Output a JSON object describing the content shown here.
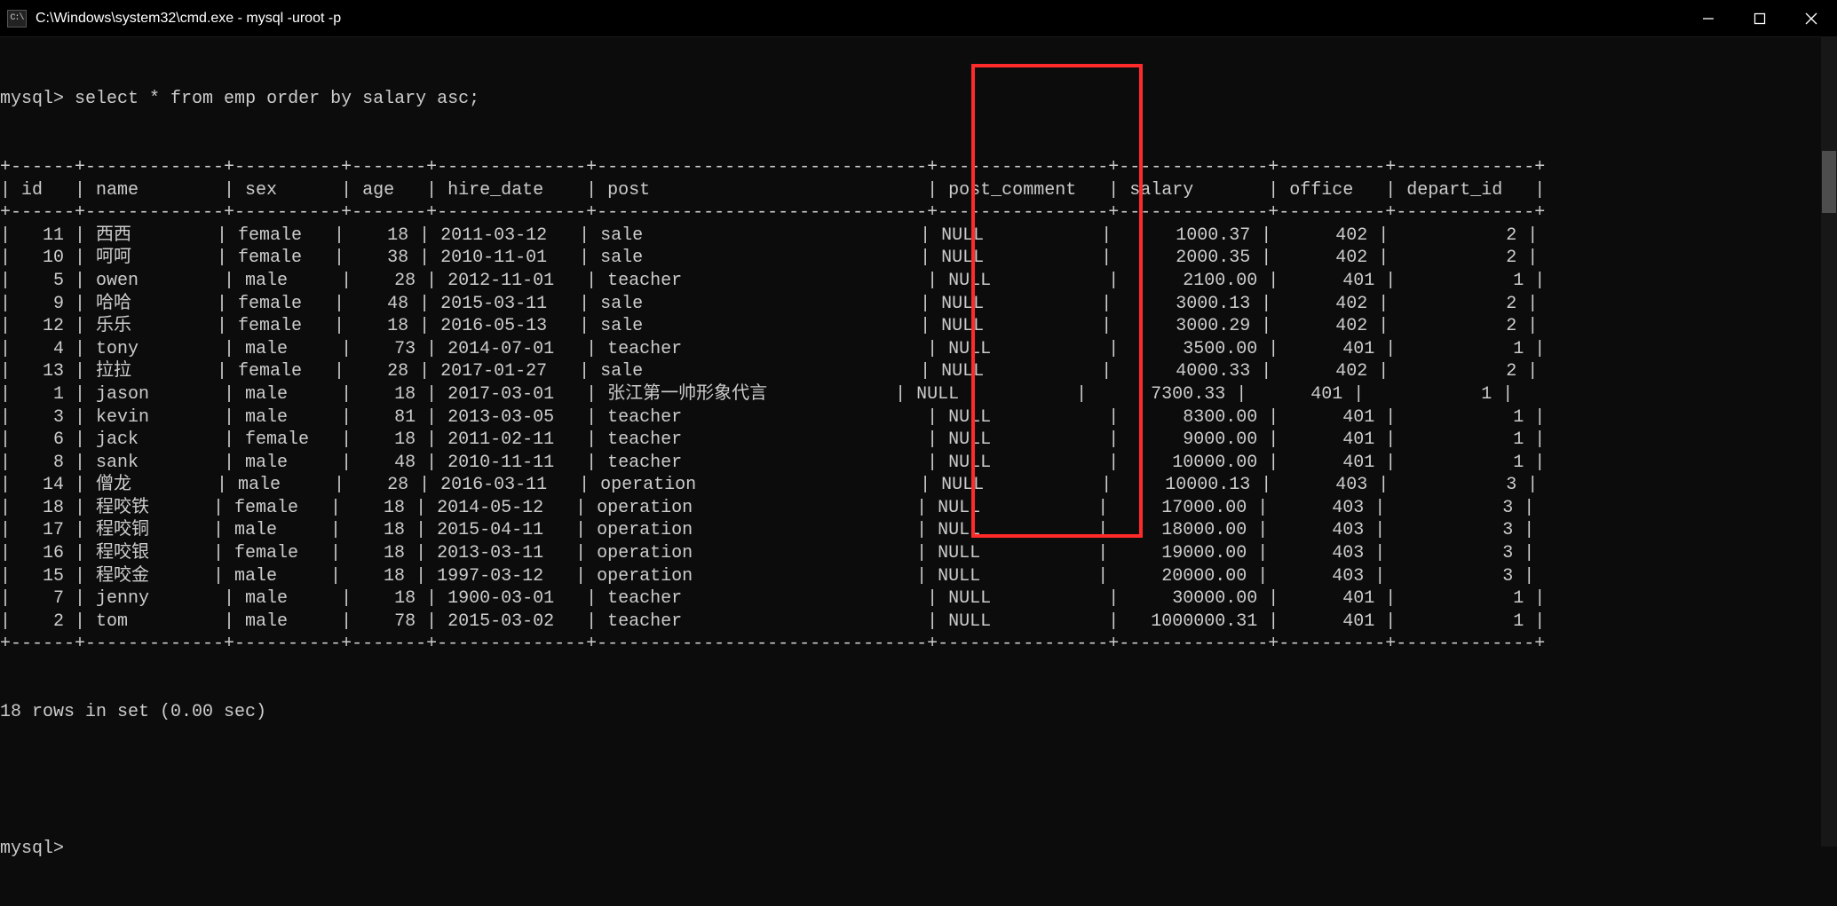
{
  "titlebar": {
    "icon_label": "cmd-icon",
    "text": "C:\\Windows\\system32\\cmd.exe - mysql  -uroot -p"
  },
  "prompt": "mysql>",
  "query": "select * from emp order by salary asc;",
  "columns": [
    "id",
    "name",
    "sex",
    "age",
    "hire_date",
    "post",
    "post_comment",
    "salary",
    "office",
    "depart_id"
  ],
  "rows": [
    {
      "id": "11",
      "name": "西西",
      "sex": "female",
      "age": "18",
      "hire_date": "2011-03-12",
      "post": "sale",
      "post_comment": "NULL",
      "salary": "1000.37",
      "office": "402",
      "depart_id": "2"
    },
    {
      "id": "10",
      "name": "呵呵",
      "sex": "female",
      "age": "38",
      "hire_date": "2010-11-01",
      "post": "sale",
      "post_comment": "NULL",
      "salary": "2000.35",
      "office": "402",
      "depart_id": "2"
    },
    {
      "id": "5",
      "name": "owen",
      "sex": "male",
      "age": "28",
      "hire_date": "2012-11-01",
      "post": "teacher",
      "post_comment": "NULL",
      "salary": "2100.00",
      "office": "401",
      "depart_id": "1"
    },
    {
      "id": "9",
      "name": "哈哈",
      "sex": "female",
      "age": "48",
      "hire_date": "2015-03-11",
      "post": "sale",
      "post_comment": "NULL",
      "salary": "3000.13",
      "office": "402",
      "depart_id": "2"
    },
    {
      "id": "12",
      "name": "乐乐",
      "sex": "female",
      "age": "18",
      "hire_date": "2016-05-13",
      "post": "sale",
      "post_comment": "NULL",
      "salary": "3000.29",
      "office": "402",
      "depart_id": "2"
    },
    {
      "id": "4",
      "name": "tony",
      "sex": "male",
      "age": "73",
      "hire_date": "2014-07-01",
      "post": "teacher",
      "post_comment": "NULL",
      "salary": "3500.00",
      "office": "401",
      "depart_id": "1"
    },
    {
      "id": "13",
      "name": "拉拉",
      "sex": "female",
      "age": "28",
      "hire_date": "2017-01-27",
      "post": "sale",
      "post_comment": "NULL",
      "salary": "4000.33",
      "office": "402",
      "depart_id": "2"
    },
    {
      "id": "1",
      "name": "jason",
      "sex": "male",
      "age": "18",
      "hire_date": "2017-03-01",
      "post": "张江第一帅形象代言",
      "post_comment": "NULL",
      "salary": "7300.33",
      "office": "401",
      "depart_id": "1"
    },
    {
      "id": "3",
      "name": "kevin",
      "sex": "male",
      "age": "81",
      "hire_date": "2013-03-05",
      "post": "teacher",
      "post_comment": "NULL",
      "salary": "8300.00",
      "office": "401",
      "depart_id": "1"
    },
    {
      "id": "6",
      "name": "jack",
      "sex": "female",
      "age": "18",
      "hire_date": "2011-02-11",
      "post": "teacher",
      "post_comment": "NULL",
      "salary": "9000.00",
      "office": "401",
      "depart_id": "1"
    },
    {
      "id": "8",
      "name": "sank",
      "sex": "male",
      "age": "48",
      "hire_date": "2010-11-11",
      "post": "teacher",
      "post_comment": "NULL",
      "salary": "10000.00",
      "office": "401",
      "depart_id": "1"
    },
    {
      "id": "14",
      "name": "僧龙",
      "sex": "male",
      "age": "28",
      "hire_date": "2016-03-11",
      "post": "operation",
      "post_comment": "NULL",
      "salary": "10000.13",
      "office": "403",
      "depart_id": "3"
    },
    {
      "id": "18",
      "name": "程咬铁",
      "sex": "female",
      "age": "18",
      "hire_date": "2014-05-12",
      "post": "operation",
      "post_comment": "NULL",
      "salary": "17000.00",
      "office": "403",
      "depart_id": "3"
    },
    {
      "id": "17",
      "name": "程咬铜",
      "sex": "male",
      "age": "18",
      "hire_date": "2015-04-11",
      "post": "operation",
      "post_comment": "NULL",
      "salary": "18000.00",
      "office": "403",
      "depart_id": "3"
    },
    {
      "id": "16",
      "name": "程咬银",
      "sex": "female",
      "age": "18",
      "hire_date": "2013-03-11",
      "post": "operation",
      "post_comment": "NULL",
      "salary": "19000.00",
      "office": "403",
      "depart_id": "3"
    },
    {
      "id": "15",
      "name": "程咬金",
      "sex": "male",
      "age": "18",
      "hire_date": "1997-03-12",
      "post": "operation",
      "post_comment": "NULL",
      "salary": "20000.00",
      "office": "403",
      "depart_id": "3"
    },
    {
      "id": "7",
      "name": "jenny",
      "sex": "male",
      "age": "18",
      "hire_date": "1900-03-01",
      "post": "teacher",
      "post_comment": "NULL",
      "salary": "30000.00",
      "office": "401",
      "depart_id": "1"
    },
    {
      "id": "2",
      "name": "tom",
      "sex": "male",
      "age": "78",
      "hire_date": "2015-03-02",
      "post": "teacher",
      "post_comment": "NULL",
      "salary": "1000000.31",
      "office": "401",
      "depart_id": "1"
    }
  ],
  "footer": "18 rows in set (0.00 sec)",
  "prompt2": "mysql>",
  "col_widths": {
    "id": 4,
    "name": 11,
    "sex": 8,
    "age": 5,
    "hire_date": 12,
    "post": 29,
    "post_comment": 14,
    "salary": 12,
    "office": 8,
    "depart_id": 11
  },
  "col_align": {
    "id": "right",
    "name": "left",
    "sex": "left",
    "age": "right",
    "hire_date": "left",
    "post": "left",
    "post_comment": "left",
    "salary": "right",
    "office": "right",
    "depart_id": "right"
  }
}
